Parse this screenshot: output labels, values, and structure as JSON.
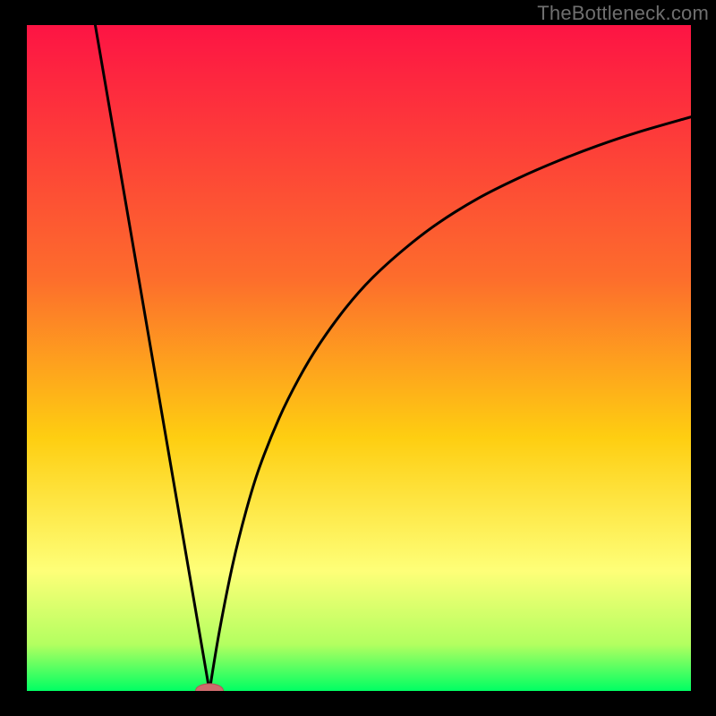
{
  "watermark": "TheBottleneck.com",
  "colors": {
    "frame": "#000000",
    "grad_top": "#fd1444",
    "grad_mid1": "#fd6d2c",
    "grad_mid2": "#fece11",
    "grad_mid3": "#feff78",
    "grad_bot1": "#b3ff60",
    "grad_bot2": "#00ff63",
    "curve": "#000000",
    "marker_fill": "#cd6b6d",
    "marker_stroke": "#b35355"
  },
  "chart_data": {
    "type": "line",
    "title": "",
    "xlabel": "",
    "ylabel": "",
    "xlim": [
      0,
      100
    ],
    "ylim": [
      0,
      100
    ],
    "notch_x": 27.5,
    "marker": {
      "x": 27.5,
      "y": 0,
      "rx": 2.1,
      "ry": 1.1
    },
    "series": [
      {
        "name": "left-branch",
        "x": [
          10.3,
          27.5
        ],
        "y": [
          100,
          0
        ]
      },
      {
        "name": "right-branch",
        "x": [
          27.5,
          29,
          31,
          33,
          35,
          38,
          41,
          44,
          48,
          52,
          57,
          62,
          68,
          74,
          80,
          86,
          92,
          100
        ],
        "y": [
          0,
          9,
          19,
          27,
          33.5,
          41,
          47,
          52,
          57.5,
          62,
          66.5,
          70.3,
          74,
          77,
          79.6,
          81.9,
          83.9,
          86.2
        ]
      }
    ]
  }
}
